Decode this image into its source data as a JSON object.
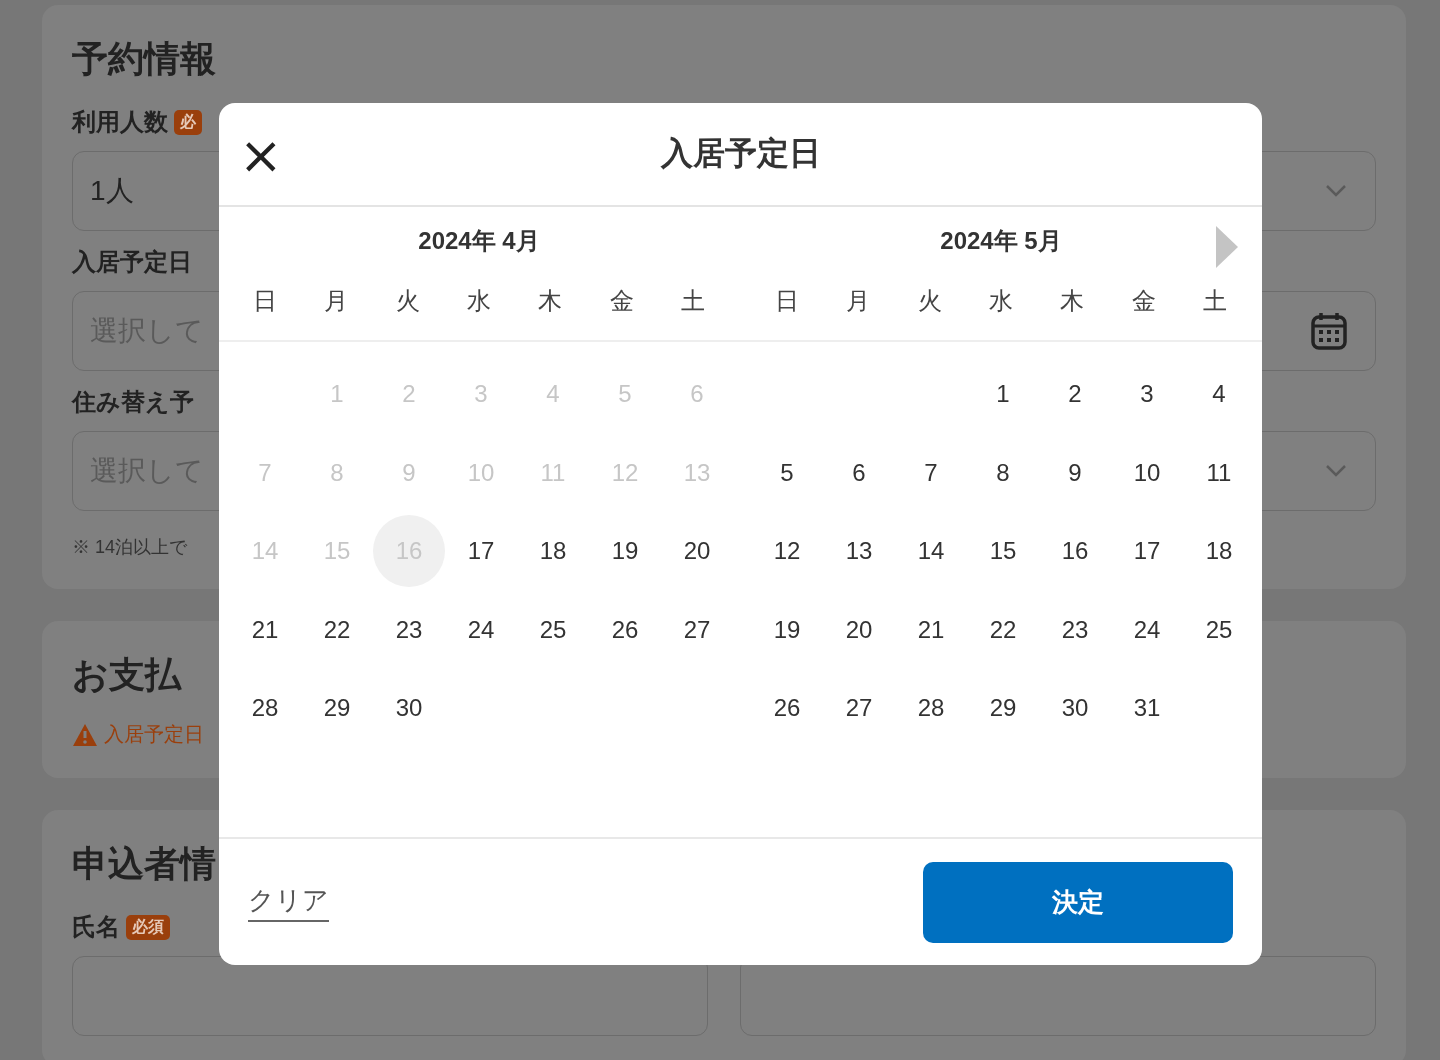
{
  "background_form": {
    "sections": [
      {
        "title": "予約情報",
        "fields": [
          {
            "label": "利用人数",
            "badge": "必",
            "value": "1人",
            "kind": "select"
          },
          {
            "label": "入居予定日",
            "placeholder": "選択して",
            "kind": "date"
          },
          {
            "label": "住み替え予",
            "placeholder": "選択して",
            "kind": "select"
          }
        ],
        "note": "※ 14泊以上で"
      },
      {
        "title": "お支払",
        "warning": "入居予定日"
      },
      {
        "title": "申込者情",
        "fields": [
          {
            "label": "氏名",
            "badge": "必須",
            "kind": "pair"
          }
        ]
      }
    ]
  },
  "dialog": {
    "close": "×",
    "title": "入居予定日",
    "months": [
      {
        "title": "2024年 4月",
        "weekdays": [
          "日",
          "月",
          "火",
          "水",
          "木",
          "金",
          "土"
        ],
        "weeks": [
          [
            {
              "kind": "blank"
            },
            {
              "kind": "day",
              "label": "1",
              "disabled": true,
              "today": false
            },
            {
              "kind": "day",
              "label": "2",
              "disabled": true,
              "today": false
            },
            {
              "kind": "day",
              "label": "3",
              "disabled": true,
              "today": false
            },
            {
              "kind": "day",
              "label": "4",
              "disabled": true,
              "today": false
            },
            {
              "kind": "day",
              "label": "5",
              "disabled": true,
              "today": false
            },
            {
              "kind": "day",
              "label": "6",
              "disabled": true,
              "today": false
            }
          ],
          [
            {
              "kind": "day",
              "label": "7",
              "disabled": true,
              "today": false
            },
            {
              "kind": "day",
              "label": "8",
              "disabled": true,
              "today": false
            },
            {
              "kind": "day",
              "label": "9",
              "disabled": true,
              "today": false
            },
            {
              "kind": "day",
              "label": "10",
              "disabled": true,
              "today": false
            },
            {
              "kind": "day",
              "label": "11",
              "disabled": true,
              "today": false
            },
            {
              "kind": "day",
              "label": "12",
              "disabled": true,
              "today": false
            },
            {
              "kind": "day",
              "label": "13",
              "disabled": true,
              "today": false
            }
          ],
          [
            {
              "kind": "day",
              "label": "14",
              "disabled": true,
              "today": false
            },
            {
              "kind": "day",
              "label": "15",
              "disabled": true,
              "today": false
            },
            {
              "kind": "day",
              "label": "16",
              "disabled": true,
              "today": true
            },
            {
              "kind": "day",
              "label": "17",
              "disabled": false,
              "today": false
            },
            {
              "kind": "day",
              "label": "18",
              "disabled": false,
              "today": false
            },
            {
              "kind": "day",
              "label": "19",
              "disabled": false,
              "today": false
            },
            {
              "kind": "day",
              "label": "20",
              "disabled": false,
              "today": false
            }
          ],
          [
            {
              "kind": "day",
              "label": "21",
              "disabled": false,
              "today": false
            },
            {
              "kind": "day",
              "label": "22",
              "disabled": false,
              "today": false
            },
            {
              "kind": "day",
              "label": "23",
              "disabled": false,
              "today": false
            },
            {
              "kind": "day",
              "label": "24",
              "disabled": false,
              "today": false
            },
            {
              "kind": "day",
              "label": "25",
              "disabled": false,
              "today": false
            },
            {
              "kind": "day",
              "label": "26",
              "disabled": false,
              "today": false
            },
            {
              "kind": "day",
              "label": "27",
              "disabled": false,
              "today": false
            }
          ],
          [
            {
              "kind": "day",
              "label": "28",
              "disabled": false,
              "today": false
            },
            {
              "kind": "day",
              "label": "29",
              "disabled": false,
              "today": false
            },
            {
              "kind": "day",
              "label": "30",
              "disabled": false,
              "today": false
            },
            {
              "kind": "blank"
            },
            {
              "kind": "blank"
            },
            {
              "kind": "blank"
            },
            {
              "kind": "blank"
            }
          ]
        ]
      },
      {
        "title": "2024年 5月",
        "weekdays": [
          "日",
          "月",
          "火",
          "水",
          "木",
          "金",
          "土"
        ],
        "weeks": [
          [
            {
              "kind": "blank"
            },
            {
              "kind": "blank"
            },
            {
              "kind": "blank"
            },
            {
              "kind": "day",
              "label": "1",
              "disabled": false,
              "today": false
            },
            {
              "kind": "day",
              "label": "2",
              "disabled": false,
              "today": false
            },
            {
              "kind": "day",
              "label": "3",
              "disabled": false,
              "today": false
            },
            {
              "kind": "day",
              "label": "4",
              "disabled": false,
              "today": false
            }
          ],
          [
            {
              "kind": "day",
              "label": "5",
              "disabled": false,
              "today": false
            },
            {
              "kind": "day",
              "label": "6",
              "disabled": false,
              "today": false
            },
            {
              "kind": "day",
              "label": "7",
              "disabled": false,
              "today": false
            },
            {
              "kind": "day",
              "label": "8",
              "disabled": false,
              "today": false
            },
            {
              "kind": "day",
              "label": "9",
              "disabled": false,
              "today": false
            },
            {
              "kind": "day",
              "label": "10",
              "disabled": false,
              "today": false
            },
            {
              "kind": "day",
              "label": "11",
              "disabled": false,
              "today": false
            }
          ],
          [
            {
              "kind": "day",
              "label": "12",
              "disabled": false,
              "today": false
            },
            {
              "kind": "day",
              "label": "13",
              "disabled": false,
              "today": false
            },
            {
              "kind": "day",
              "label": "14",
              "disabled": false,
              "today": false
            },
            {
              "kind": "day",
              "label": "15",
              "disabled": false,
              "today": false
            },
            {
              "kind": "day",
              "label": "16",
              "disabled": false,
              "today": false
            },
            {
              "kind": "day",
              "label": "17",
              "disabled": false,
              "today": false
            },
            {
              "kind": "day",
              "label": "18",
              "disabled": false,
              "today": false
            }
          ],
          [
            {
              "kind": "day",
              "label": "19",
              "disabled": false,
              "today": false
            },
            {
              "kind": "day",
              "label": "20",
              "disabled": false,
              "today": false
            },
            {
              "kind": "day",
              "label": "21",
              "disabled": false,
              "today": false
            },
            {
              "kind": "day",
              "label": "22",
              "disabled": false,
              "today": false
            },
            {
              "kind": "day",
              "label": "23",
              "disabled": false,
              "today": false
            },
            {
              "kind": "day",
              "label": "24",
              "disabled": false,
              "today": false
            },
            {
              "kind": "day",
              "label": "25",
              "disabled": false,
              "today": false
            }
          ],
          [
            {
              "kind": "day",
              "label": "26",
              "disabled": false,
              "today": false
            },
            {
              "kind": "day",
              "label": "27",
              "disabled": false,
              "today": false
            },
            {
              "kind": "day",
              "label": "28",
              "disabled": false,
              "today": false
            },
            {
              "kind": "day",
              "label": "29",
              "disabled": false,
              "today": false
            },
            {
              "kind": "day",
              "label": "30",
              "disabled": false,
              "today": false
            },
            {
              "kind": "day",
              "label": "31",
              "disabled": false,
              "today": false
            },
            {
              "kind": "blank"
            }
          ]
        ]
      }
    ],
    "clear": "クリア",
    "confirm": "決定"
  }
}
